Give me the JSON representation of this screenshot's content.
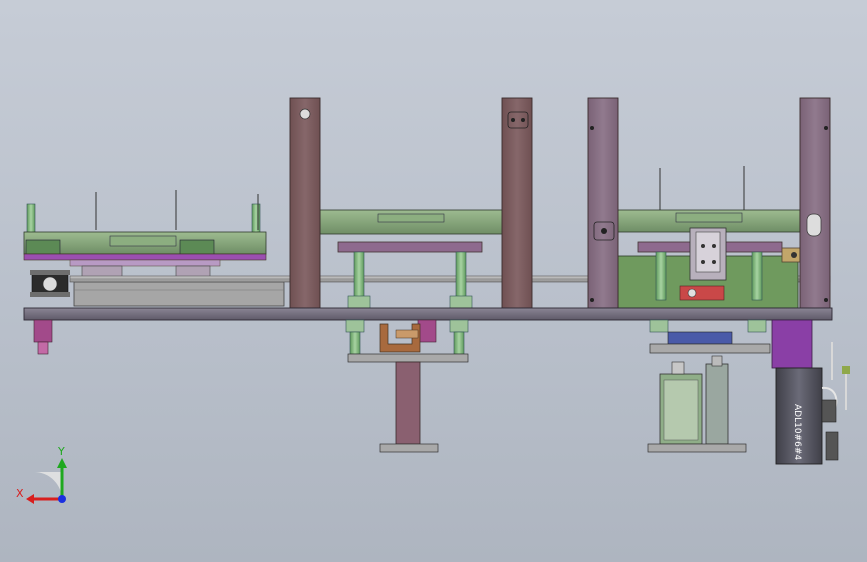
{
  "view": {
    "background_top": "#c6ccd6",
    "background_bottom": "#aeb5c0"
  },
  "axes": {
    "x_label": "X",
    "y_label": "Y",
    "x_color": "#d81e1e",
    "y_color": "#1fa81f",
    "z_color": "#1a2fe0"
  },
  "motor": {
    "label": "ADL10#6#4"
  },
  "colors": {
    "frame_plate": "#7d5c5e",
    "frame_plate_light": "#8a6a78",
    "base_plate": "#757080",
    "carriage": "#7f9e74",
    "guide_rail": "#a8a8a8",
    "pin": "#7fb07a",
    "purple": "#8a3fa6",
    "motor_body": "#5a5a66",
    "bracket": "#a86a3e",
    "cylinder": "#6e8a6a"
  }
}
